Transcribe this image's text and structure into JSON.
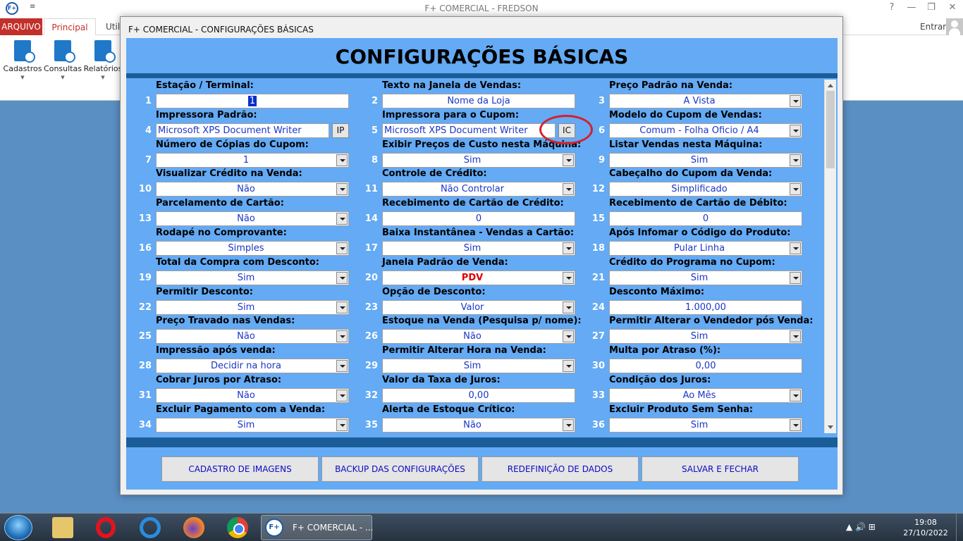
{
  "app": {
    "logo": "F+",
    "title": "F+ COMERCIAL - FREDSON",
    "help": "?",
    "window_buttons": [
      "—",
      "❐",
      "✕"
    ],
    "qat": "≡"
  },
  "ribbon": {
    "tabs": [
      {
        "label": "ARQUIVO"
      },
      {
        "label": "Principal"
      },
      {
        "label": "Util"
      }
    ],
    "signin": "Entrar",
    "buttons": [
      {
        "label": "Cadastros",
        "icon": "cadastros-icon"
      },
      {
        "label": "Consultas",
        "icon": "consultas-icon"
      },
      {
        "label": "Relatórios",
        "icon": "relatorios-icon"
      }
    ]
  },
  "dialog": {
    "title": "F+ COMERCIAL - CONFIGURAÇÕES BÁSICAS",
    "heading": "CONFIGURAÇÕES BÁSICAS",
    "fields": [
      {
        "num": "1",
        "label": "Estação / Terminal:",
        "value": "1"
      },
      {
        "num": "2",
        "label": "Texto na Janela de Vendas:",
        "value": "Nome da Loja"
      },
      {
        "num": "3",
        "label": "Preço Padrão na Venda:",
        "value": "A Vista"
      },
      {
        "num": "4",
        "label": "Impressora Padrão:",
        "value": "Microsoft XPS Document Writer",
        "button": "IP"
      },
      {
        "num": "5",
        "label": "Impressora para o Cupom:",
        "value": "Microsoft XPS Document Writer",
        "button": "IC"
      },
      {
        "num": "6",
        "label": "Modelo do Cupom de Vendas:",
        "value": "Comum - Folha Oficio / A4"
      },
      {
        "num": "7",
        "label": "Número de Cópias do Cupom:",
        "value": "1"
      },
      {
        "num": "8",
        "label": "Exibir Preços de Custo nesta Máquina:",
        "value": "Sim"
      },
      {
        "num": "9",
        "label": "Listar Vendas nesta Máquina:",
        "value": "Sim"
      },
      {
        "num": "10",
        "label": "Visualizar Crédito na Venda:",
        "value": "Não"
      },
      {
        "num": "11",
        "label": "Controle de Crédito:",
        "value": "Não Controlar"
      },
      {
        "num": "12",
        "label": "Cabeçalho do Cupom da Venda:",
        "value": "Simplificado"
      },
      {
        "num": "13",
        "label": "Parcelamento de Cartão:",
        "value": "Não"
      },
      {
        "num": "14",
        "label": "Recebimento de Cartão de Crédito:",
        "value": "0"
      },
      {
        "num": "15",
        "label": "Recebimento de Cartão de Débito:",
        "value": "0"
      },
      {
        "num": "16",
        "label": "Rodapé no Comprovante:",
        "value": "Simples"
      },
      {
        "num": "17",
        "label": "Baixa Instantânea - Vendas a Cartão:",
        "value": "Sim"
      },
      {
        "num": "18",
        "label": "Após Infomar o Código do Produto:",
        "value": "Pular Linha"
      },
      {
        "num": "19",
        "label": "Total da Compra com Desconto:",
        "value": "Sim"
      },
      {
        "num": "20",
        "label": "Janela Padrão de Venda:",
        "value": "PDV"
      },
      {
        "num": "21",
        "label": "Crédito do Programa no Cupom:",
        "value": "Sim"
      },
      {
        "num": "22",
        "label": "Permitir Desconto:",
        "value": "Sim"
      },
      {
        "num": "23",
        "label": "Opção de Desconto:",
        "value": "Valor"
      },
      {
        "num": "24",
        "label": "Desconto Máximo:",
        "value": "1.000,00"
      },
      {
        "num": "25",
        "label": "Preço Travado nas Vendas:",
        "value": "Não"
      },
      {
        "num": "26",
        "label": "Estoque na Venda (Pesquisa p/ nome):",
        "value": "Não"
      },
      {
        "num": "27",
        "label": "Permitir Alterar o Vendedor pós Venda:",
        "value": "Sim"
      },
      {
        "num": "28",
        "label": "Impressão após venda:",
        "value": "Decidir na hora"
      },
      {
        "num": "29",
        "label": "Permitir Alterar Hora na Venda:",
        "value": "Sim"
      },
      {
        "num": "30",
        "label": "Multa por Atraso (%):",
        "value": "0,00"
      },
      {
        "num": "31",
        "label": "Cobrar Juros por Atraso:",
        "value": "Não"
      },
      {
        "num": "32",
        "label": "Valor da Taxa de Juros:",
        "value": "0,00"
      },
      {
        "num": "33",
        "label": "Condição dos Juros:",
        "value": "Ao Mês"
      },
      {
        "num": "34",
        "label": "Excluir Pagamento com a Venda:",
        "value": "Sim"
      },
      {
        "num": "35",
        "label": "Alerta de Estoque Crítico:",
        "value": "Não"
      },
      {
        "num": "36",
        "label": "Excluir Produto Sem Senha:",
        "value": "Sim"
      }
    ],
    "actions": [
      {
        "label": "CADASTRO DE IMAGENS"
      },
      {
        "label": "BACKUP DAS CONFIGURAÇÕES"
      },
      {
        "label": "REDEFINIÇÃO DE DADOS"
      },
      {
        "label": "SALVAR E FECHAR"
      }
    ]
  },
  "taskbar": {
    "app_label": "F+ COMERCIAL - ...",
    "tray": "▲  🔊  ⊞",
    "time": "19:08",
    "date": "27/10/2022"
  }
}
